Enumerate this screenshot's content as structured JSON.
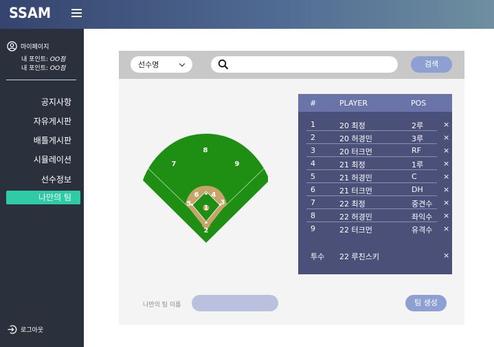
{
  "header": {
    "logo": "SSAM"
  },
  "sidebar": {
    "mypage_label": "마이페이지",
    "points": [
      {
        "label": "내 포인트: ",
        "value": "OO점"
      },
      {
        "label": "내 포인트: ",
        "value": "OO점"
      }
    ],
    "nav": [
      {
        "label": "공지사항"
      },
      {
        "label": "자유게시판"
      },
      {
        "label": "배틀게시판"
      },
      {
        "label": "시뮬레이션"
      },
      {
        "label": "선수정보"
      }
    ],
    "active_nav": "나만의 팀",
    "logout_label": "로그아웃"
  },
  "search": {
    "select_value": "선수명",
    "query": "",
    "button_label": "검색"
  },
  "field": {
    "positions": [
      "1",
      "2",
      "3",
      "4",
      "5",
      "6",
      "7",
      "8",
      "9"
    ],
    "colors": {
      "grass": "#1e8f13",
      "dirt": "#c8a46a"
    }
  },
  "roster": {
    "headers": {
      "num": "#",
      "player": "PLAYER",
      "pos": "POS"
    },
    "rows": [
      {
        "num": "1",
        "player": "20 최정",
        "pos": "2루",
        "remove": "×"
      },
      {
        "num": "2",
        "player": "20 허경민",
        "pos": "3루",
        "remove": "×"
      },
      {
        "num": "3",
        "player": "20 터크먼",
        "pos": "RF",
        "remove": "×"
      },
      {
        "num": "4",
        "player": "21 최정",
        "pos": "1루",
        "remove": "×"
      },
      {
        "num": "5",
        "player": "21 허경민",
        "pos": "C",
        "remove": "×"
      },
      {
        "num": "6",
        "player": "21 터크먼",
        "pos": "DH",
        "remove": "×"
      },
      {
        "num": "7",
        "player": "22 최정",
        "pos": "중견수",
        "remove": "×"
      },
      {
        "num": "8",
        "player": "22 허경민",
        "pos": "좌익수",
        "remove": "×"
      },
      {
        "num": "9",
        "player": "22 터크먼",
        "pos": "유격수",
        "remove": "×"
      }
    ],
    "pitcher": {
      "label": "투수",
      "player": "22 루친스키",
      "remove": "×"
    }
  },
  "team": {
    "name_label": "나만의 팀 이름",
    "name_value": "",
    "create_label": "팀 생성"
  },
  "colors": {
    "accent": "#2fcba6",
    "button": "#8e9fd2",
    "sidebar": "#2b303d",
    "roster_bg": "#4a5078",
    "roster_head": "#6a74a8"
  }
}
